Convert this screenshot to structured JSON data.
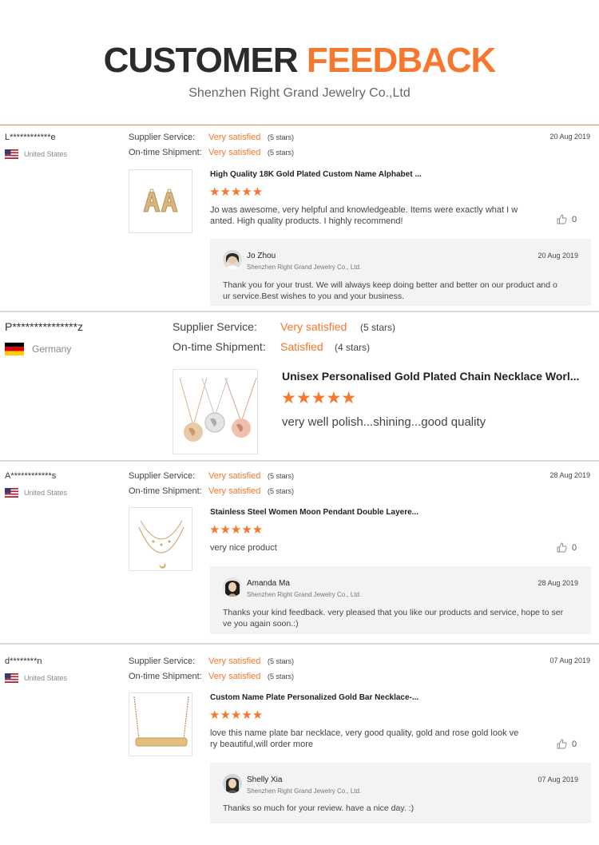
{
  "header": {
    "title_dark": "CUSTOMER",
    "title_accent": "FEEDBACK",
    "subtitle": "Shenzhen Right Grand Jewelry Co.,Ltd",
    "accent_color": "#f7772c"
  },
  "labels": {
    "supplier_service": "Supplier Service:",
    "ontime_shipment": "On-time Shipment:"
  },
  "reviews": [
    {
      "buyer": "L************e",
      "country": "United States",
      "flag": "us-flag",
      "supplier_service": "Very satisfied",
      "supplier_stars": "(5 stars)",
      "ontime_shipment": "Very satisfied",
      "ontime_stars": "(5 stars)",
      "date": "20 Aug 2019",
      "product": "High Quality 18K Gold Plated Custom Name Alphabet ...",
      "rating": 5,
      "stars_text": "★★★★★",
      "comment_line1": "Jo was awesome, very helpful and knowledgeable. Items were exactly what I w",
      "comment_line2": "anted. High quality products. I highly recommend!",
      "likes": "0",
      "reply": {
        "name": "Jo Zhou",
        "company": "Shenzhen Right Grand Jewelry Co., Ltd.",
        "date": "20 Aug 2019",
        "text_line1": "Thank you for your trust. We will always keep doing better and better on our product  and o",
        "text_line2": "ur service.Best wishes  to you and your business."
      }
    },
    {
      "buyer": "P***************z",
      "country": "Germany",
      "flag": "de-flag",
      "supplier_service": "Very satisfied",
      "supplier_stars": "(5 stars)",
      "ontime_shipment": "Satisfied",
      "ontime_stars": "(4 stars)",
      "product": "Unisex Personalised Gold Plated Chain Necklace Worl...",
      "rating": 5,
      "stars_text": "★★★★★",
      "comment_line1": "very well polish...shining...good quality"
    },
    {
      "buyer": "A************s",
      "country": "United States",
      "flag": "us-flag",
      "supplier_service": "Very satisfied",
      "supplier_stars": "(5 stars)",
      "ontime_shipment": "Very satisfied",
      "ontime_stars": "(5 stars)",
      "date": "28 Aug 2019",
      "product": "Stainless Steel Women Moon Pendant Double Layere...",
      "rating": 5,
      "stars_text": "★★★★★",
      "comment_line1": "very nice product",
      "likes": "0",
      "reply": {
        "name": "Amanda Ma",
        "company": "Shenzhen Right Grand Jewelry Co., Ltd.",
        "date": "28 Aug 2019",
        "text_line1": "Thanks your kind feedback. very pleased that you like our products and service, hope to ser",
        "text_line2": "ve you again soon.:)"
      }
    },
    {
      "buyer": "d********n",
      "country": "United States",
      "flag": "us-flag",
      "supplier_service": "Very satisfied",
      "supplier_stars": "(5 stars)",
      "ontime_shipment": "Very satisfied",
      "ontime_stars": "(5 stars)",
      "date": "07 Aug 2019",
      "product": "Custom Name Plate Personalized Gold Bar Necklace-...",
      "rating": 5,
      "stars_text": "★★★★★",
      "comment_line1": "love this name plate bar necklace, very good quality, gold and rose gold look ve",
      "comment_line2": "ry beautiful,will order more",
      "likes": "0",
      "reply": {
        "name": "Shelly Xia",
        "company": "Shenzhen Right Grand Jewelry Co., Ltd.",
        "date": "07 Aug 2019",
        "text_line1": "Thanks so much for your review. have a nice day. :)"
      }
    }
  ]
}
